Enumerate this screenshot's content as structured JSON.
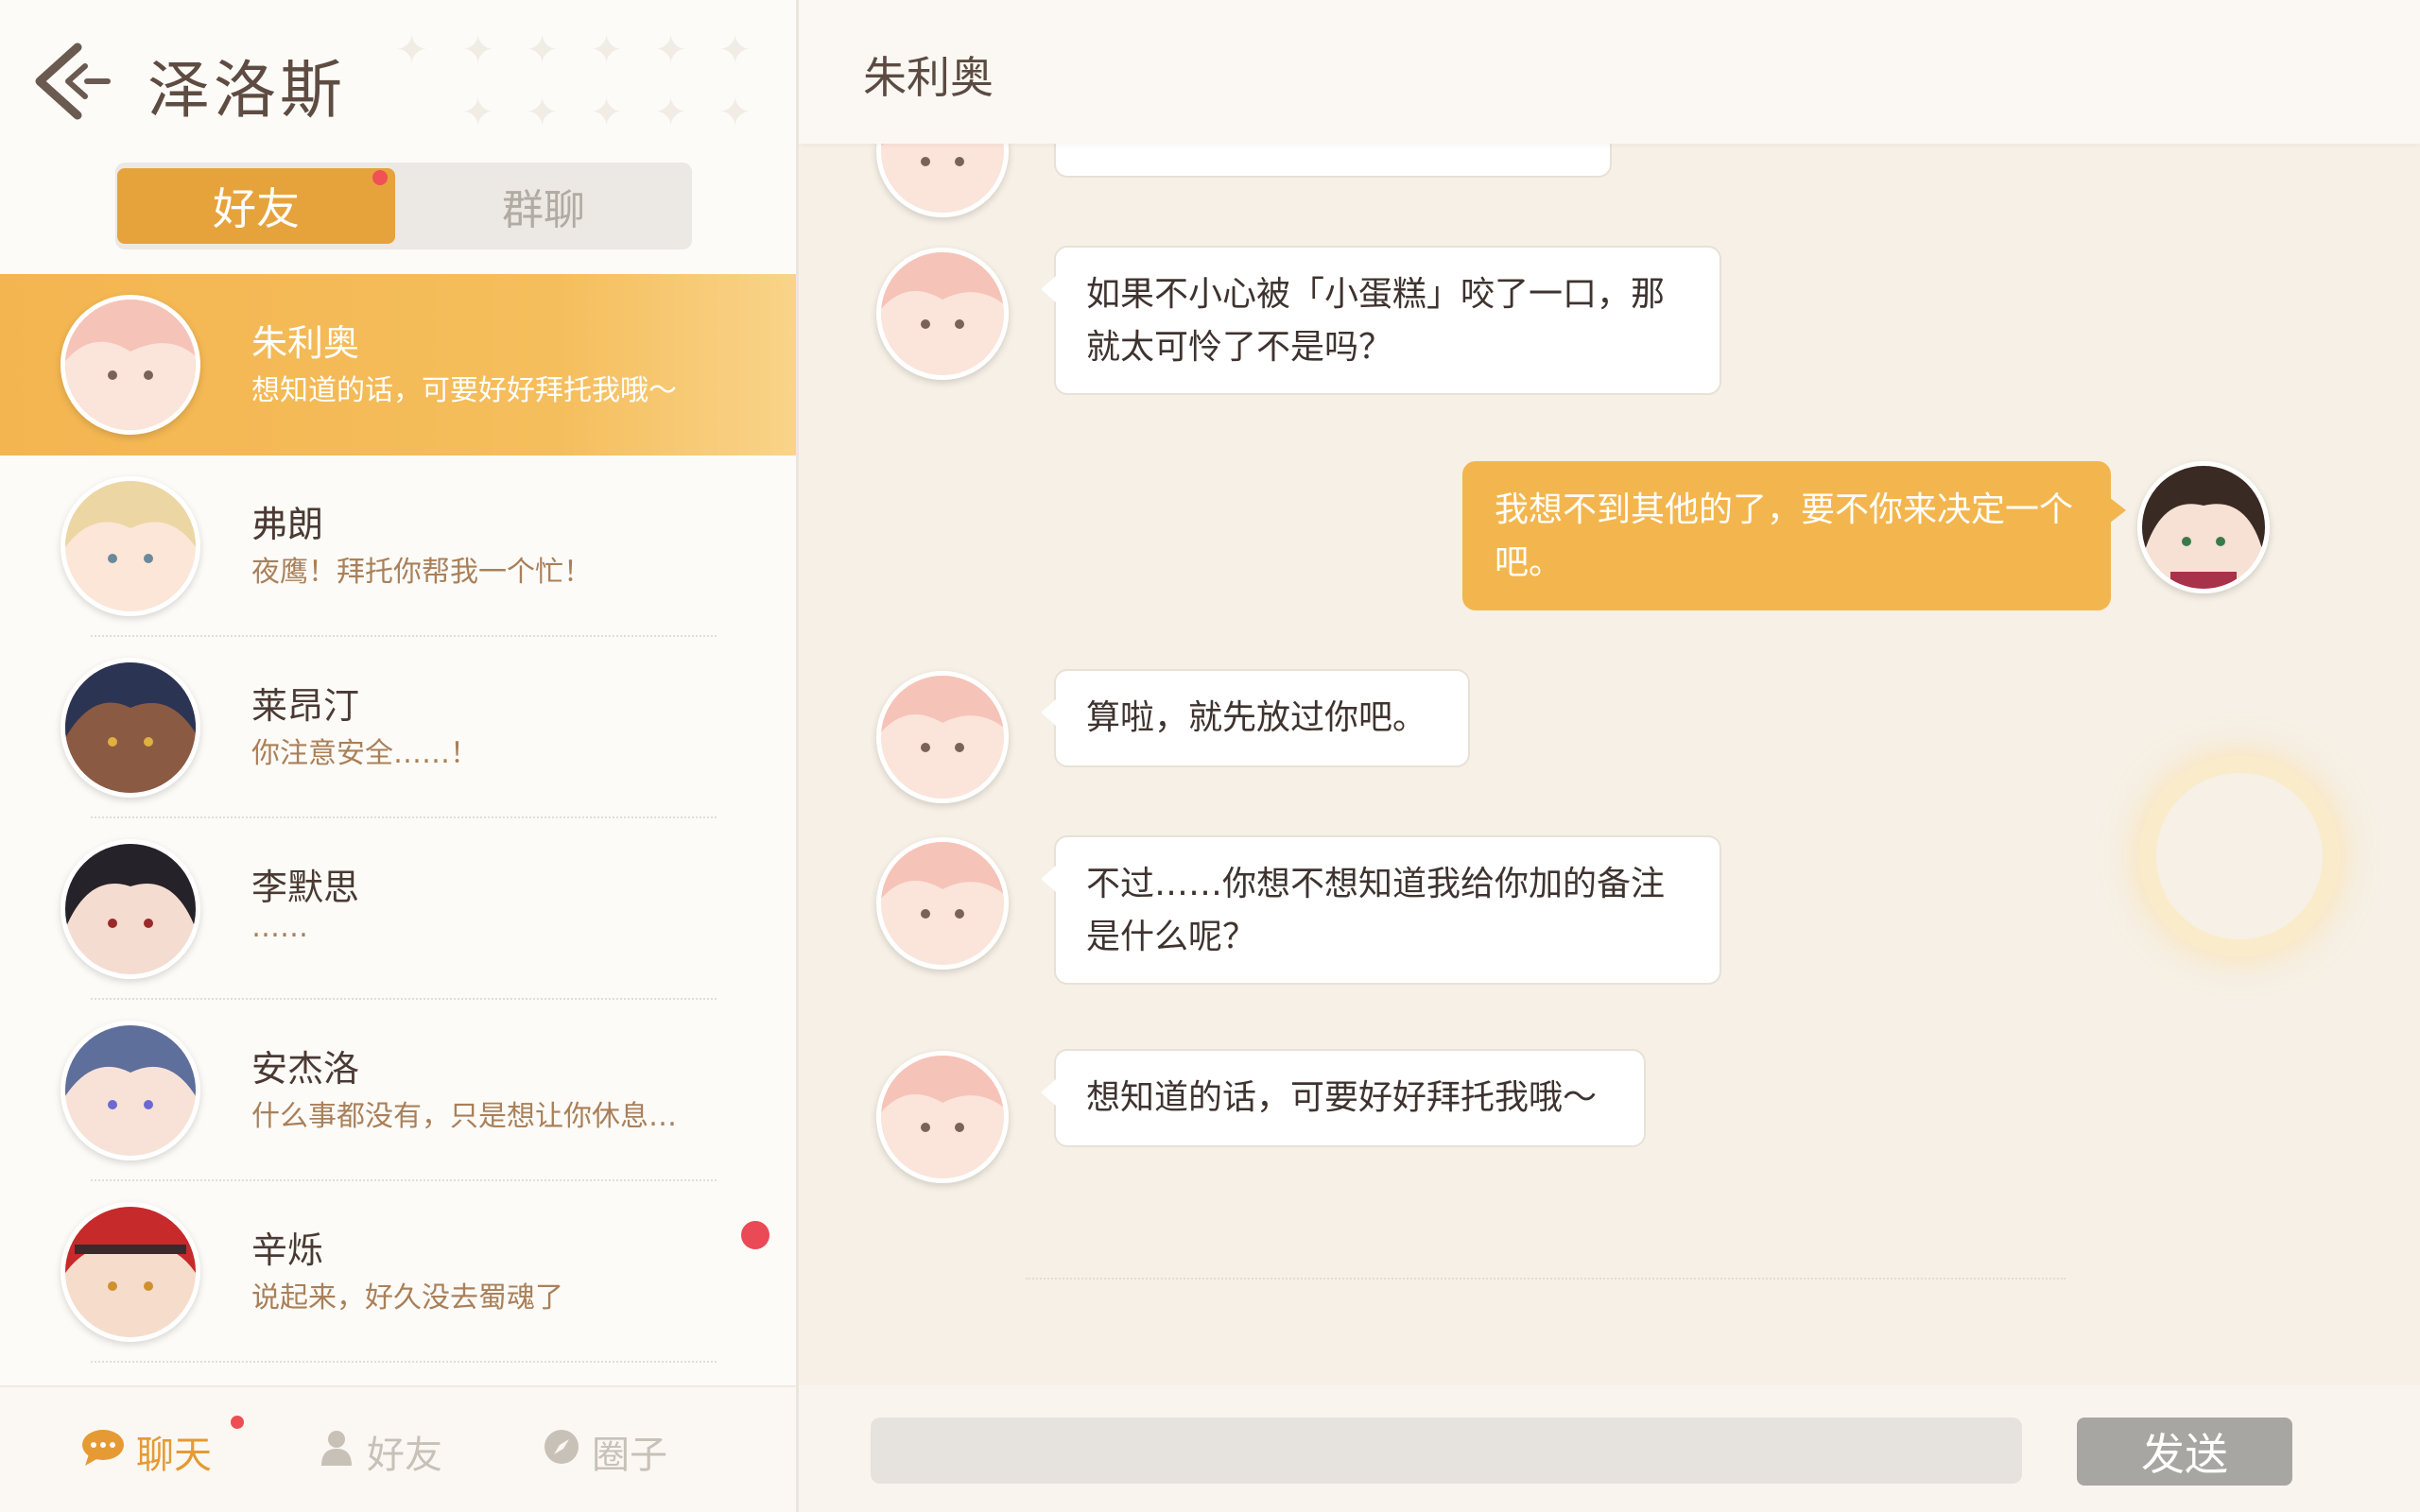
{
  "header": {
    "user_name": "泽洛斯"
  },
  "tabs": {
    "friends": "好友",
    "groups": "群聊"
  },
  "contacts": [
    {
      "name": "朱利奥",
      "last_message": "想知道的话，可要好好拜托我哦～",
      "hair": "#f6c3b8",
      "skin": "#fbe4da"
    },
    {
      "name": "弗朗",
      "last_message": "夜鹰！拜托你帮我一个忙！",
      "hair": "#ecd6a4",
      "skin": "#fbe6d8"
    },
    {
      "name": "莱昂汀",
      "last_message": "你注意安全……！",
      "hair": "#2c3454",
      "skin": "#8a5a43"
    },
    {
      "name": "李默思",
      "last_message": "……",
      "hair": "#262229",
      "skin": "#f4dcd1"
    },
    {
      "name": "安杰洛",
      "last_message": "什么事都没有，只是想让你休息…",
      "hair": "#5d6f9a",
      "skin": "#f8e2d8"
    },
    {
      "name": "辛烁",
      "last_message": "说起来，好久没去蜀魂了",
      "hair": "#c62a2a",
      "skin": "#f6dccb"
    }
  ],
  "bottom_nav": {
    "chat": "聊天",
    "friends": "好友",
    "moments": "圈子"
  },
  "chat": {
    "title": "朱利奥",
    "messages": [
      {
        "from": "contact",
        "text": "如果不小心被「小蛋糕」咬了一口，那就太可怜了不是吗？"
      },
      {
        "from": "me",
        "text": "我想不到其他的了，要不你来决定一个吧。"
      },
      {
        "from": "contact",
        "text": "算啦，就先放过你吧。"
      },
      {
        "from": "contact",
        "text": "不过……你想不想知道我给你加的备注是什么呢？"
      },
      {
        "from": "contact",
        "text": "想知道的话，可要好好拜托我哦～"
      }
    ],
    "send_label": "发送",
    "input_value": ""
  },
  "colors": {
    "accent": "#f3b64e",
    "unread": "#ea4a55"
  }
}
